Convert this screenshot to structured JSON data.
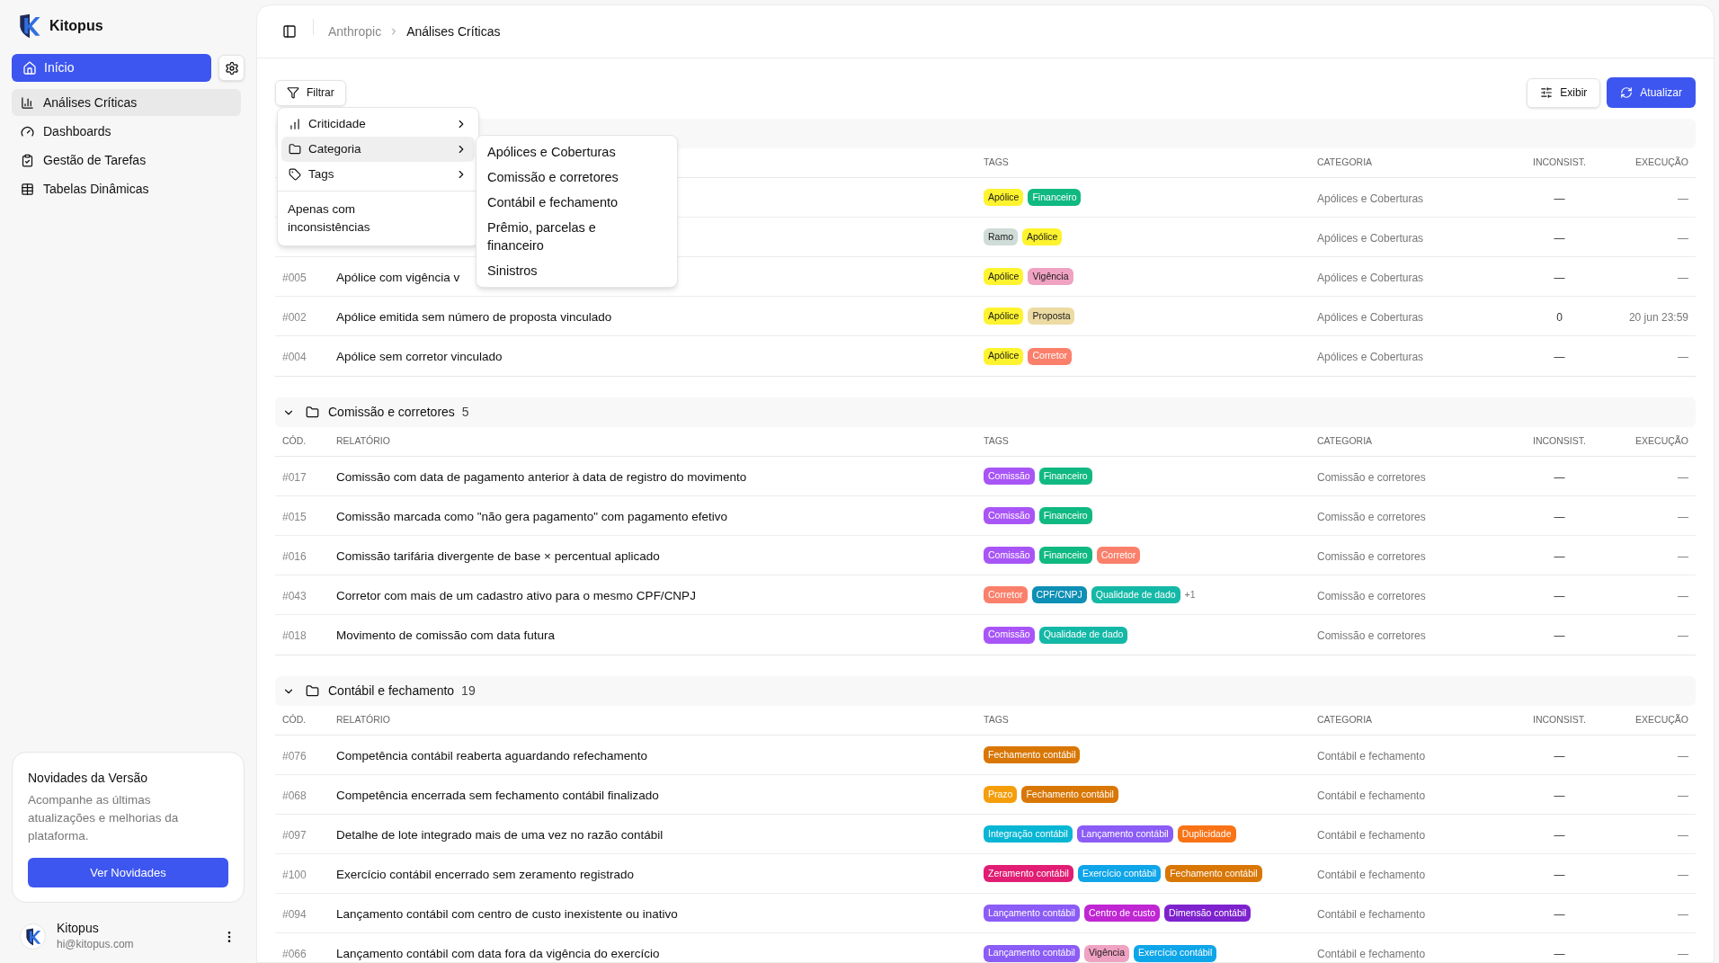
{
  "brand": {
    "name": "Kitopus"
  },
  "home_button": {
    "label": "Início",
    "active": true
  },
  "nav": [
    {
      "label": "Análises Críticas",
      "selected": true
    },
    {
      "label": "Dashboards",
      "selected": false
    },
    {
      "label": "Gestão de Tarefas",
      "selected": false
    },
    {
      "label": "Tabelas Dinâmicas",
      "selected": false
    }
  ],
  "news_card": {
    "title": "Novidades da Versão",
    "text": "Acompanhe as últimas atualizações e melhorias da plataforma.",
    "button": "Ver Novidades"
  },
  "user": {
    "name": "Kitopus",
    "email": "hi@kitopus.com"
  },
  "breadcrumb": [
    "Anthropic",
    "Análises Críticas"
  ],
  "toolbar": {
    "filter": "Filtrar",
    "view": "Exibir",
    "refresh": "Atualizar"
  },
  "filter_menu": {
    "items": [
      {
        "label": "Criticidade",
        "highlighted": false
      },
      {
        "label": "Categoria",
        "highlighted": true
      },
      {
        "label": "Tags",
        "highlighted": false
      }
    ],
    "toggle": "Apenas com inconsistências",
    "submenu": [
      "Apólices e Coberturas",
      "Comissão e corretores",
      "Contábil e fechamento",
      "Prêmio, parcelas e financeiro",
      "Sinistros"
    ]
  },
  "groups": [
    {
      "columns": {
        "tags": "TAGS",
        "category": "CATEGORIA",
        "inconsist": "INCONSIST.",
        "execution": "EXECUÇÃO"
      },
      "rows": [
        {
          "tags": [
            {
              "label": "Apólice",
              "color": "#fef32f"
            },
            {
              "label": "Financeiro",
              "color": "#10b981"
            }
          ],
          "category": "Apólices e Coberturas",
          "inconsist": "—",
          "execution": "—"
        },
        {
          "tags": [
            {
              "label": "Ramo",
              "color": "#cfdcd8"
            },
            {
              "label": "Apólice",
              "color": "#fef32f"
            }
          ],
          "category": "Apólices e Coberturas",
          "inconsist": "—",
          "execution": "—"
        },
        {
          "code": "#005",
          "title": "Apólice com vigência v",
          "tags": [
            {
              "label": "Apólice",
              "color": "#fef32f"
            },
            {
              "label": "Vigência",
              "color": "#f0a2c2"
            }
          ],
          "category": "Apólices e Coberturas",
          "inconsist": "—",
          "execution": "—"
        },
        {
          "code": "#002",
          "title": "Apólice emitida sem número de proposta vinculado",
          "tags": [
            {
              "label": "Apólice",
              "color": "#fef32f"
            },
            {
              "label": "Proposta",
              "color": "#ecdba2"
            }
          ],
          "category": "Apólices e Coberturas",
          "inconsist": "0",
          "execution": "20 jun 23:59"
        },
        {
          "code": "#004",
          "title": "Apólice sem corretor vinculado",
          "tags": [
            {
              "label": "Apólice",
              "color": "#fef32f"
            },
            {
              "label": "Corretor",
              "color": "#fa806b"
            }
          ],
          "category": "Apólices e Coberturas",
          "inconsist": "—",
          "execution": "—"
        }
      ]
    },
    {
      "name": "Comissão e corretores",
      "count": "5",
      "expanded": true,
      "columns": {
        "code": "CÓD.",
        "title": "RELATÓRIO",
        "tags": "TAGS",
        "category": "CATEGORIA",
        "inconsist": "INCONSIST.",
        "execution": "EXECUÇÃO"
      },
      "rows": [
        {
          "code": "#017",
          "title": "Comissão com data de pagamento anterior à data de registro do movimento",
          "tags": [
            {
              "label": "Comissão",
              "color": "#a855f7"
            },
            {
              "label": "Financeiro",
              "color": "#10b981"
            }
          ],
          "category": "Comissão e corretores",
          "inconsist": "—",
          "execution": "—"
        },
        {
          "code": "#015",
          "title": "Comissão marcada como \"não gera pagamento\" com pagamento efetivo",
          "tags": [
            {
              "label": "Comissão",
              "color": "#a855f7"
            },
            {
              "label": "Financeiro",
              "color": "#10b981"
            }
          ],
          "category": "Comissão e corretores",
          "inconsist": "—",
          "execution": "—"
        },
        {
          "code": "#016",
          "title": "Comissão tarifária divergente de base × percentual aplicado",
          "tags": [
            {
              "label": "Comissão",
              "color": "#a855f7"
            },
            {
              "label": "Financeiro",
              "color": "#10b981"
            },
            {
              "label": "Corretor",
              "color": "#fa806b"
            }
          ],
          "category": "Comissão e corretores",
          "inconsist": "—",
          "execution": "—"
        },
        {
          "code": "#043",
          "title": "Corretor com mais de um cadastro ativo para o mesmo CPF/CNPJ",
          "tags": [
            {
              "label": "Corretor",
              "color": "#fa806b"
            },
            {
              "label": "CPF/CNPJ",
              "color": "#0e8fb5"
            },
            {
              "label": "Qualidade de dado",
              "color": "#14b8a6"
            }
          ],
          "more": "+1",
          "category": "Comissão e corretores",
          "inconsist": "—",
          "execution": "—"
        },
        {
          "code": "#018",
          "title": "Movimento de comissão com data futura",
          "tags": [
            {
              "label": "Comissão",
              "color": "#a855f7"
            },
            {
              "label": "Qualidade de dado",
              "color": "#14b8a6"
            }
          ],
          "category": "Comissão e corretores",
          "inconsist": "—",
          "execution": "—"
        }
      ]
    },
    {
      "name": "Contábil e fechamento",
      "count": "19",
      "expanded": true,
      "columns": {
        "code": "CÓD.",
        "title": "RELATÓRIO",
        "tags": "TAGS",
        "category": "CATEGORIA",
        "inconsist": "INCONSIST.",
        "execution": "EXECUÇÃO"
      },
      "rows": [
        {
          "code": "#076",
          "title": "Competência contábil reaberta aguardando refechamento",
          "tags": [
            {
              "label": "Fechamento contábil",
              "color": "#d97706"
            }
          ],
          "category": "Contábil e fechamento",
          "inconsist": "—",
          "execution": "—"
        },
        {
          "code": "#068",
          "title": "Competência encerrada sem fechamento contábil finalizado",
          "tags": [
            {
              "label": "Prazo",
              "color": "#f59e0b"
            },
            {
              "label": "Fechamento contábil",
              "color": "#d97706"
            }
          ],
          "category": "Contábil e fechamento",
          "inconsist": "—",
          "execution": "—"
        },
        {
          "code": "#097",
          "title": "Detalhe de lote integrado mais de uma vez no razão contábil",
          "tags": [
            {
              "label": "Integração contábil",
              "color": "#06b6d4"
            },
            {
              "label": "Lançamento contábil",
              "color": "#8b5cf6"
            },
            {
              "label": "Duplicidade",
              "color": "#f97316"
            }
          ],
          "category": "Contábil e fechamento",
          "inconsist": "—",
          "execution": "—"
        },
        {
          "code": "#100",
          "title": "Exercício contábil encerrado sem zeramento registrado",
          "tags": [
            {
              "label": "Zeramento contábil",
              "color": "#e11d74"
            },
            {
              "label": "Exercício contábil",
              "color": "#0ea5e9"
            },
            {
              "label": "Fechamento contábil",
              "color": "#d97706"
            }
          ],
          "category": "Contábil e fechamento",
          "inconsist": "—",
          "execution": "—"
        },
        {
          "code": "#094",
          "title": "Lançamento contábil com centro de custo inexistente ou inativo",
          "tags": [
            {
              "label": "Lançamento contábil",
              "color": "#8b5cf6"
            },
            {
              "label": "Centro de custo",
              "color": "#c026d3"
            },
            {
              "label": "Dimensão contábil",
              "color": "#7e22ce"
            }
          ],
          "category": "Contábil e fechamento",
          "inconsist": "—",
          "execution": "—"
        },
        {
          "code": "#066",
          "title": "Lançamento contábil com data fora da vigência do exercício",
          "tags": [
            {
              "label": "Lançamento contábil",
              "color": "#8b5cf6"
            },
            {
              "label": "Vigência",
              "color": "#f0a2c2"
            },
            {
              "label": "Exercício contábil",
              "color": "#0ea5e9"
            }
          ],
          "category": "Contábil e fechamento",
          "inconsist": "—",
          "execution": "—"
        }
      ]
    }
  ]
}
